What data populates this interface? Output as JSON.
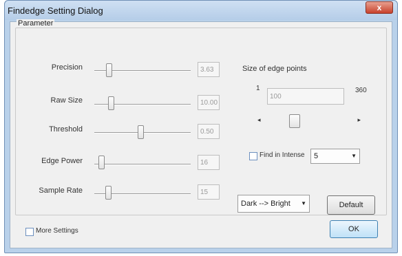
{
  "window": {
    "title": "Findedge Setting Dialog",
    "close_label": "x"
  },
  "parameter_group": {
    "title": "Parameter",
    "params": [
      {
        "label": "Precision",
        "value": "3.63",
        "slider_fraction": 0.15
      },
      {
        "label": "Raw Size",
        "value": "10.00",
        "slider_fraction": 0.17
      },
      {
        "label": "Threshold",
        "value": "0.50",
        "slider_fraction": 0.48
      },
      {
        "label": "Edge Power",
        "value": "16",
        "slider_fraction": 0.07
      },
      {
        "label": "Sample Rate",
        "value": "15",
        "slider_fraction": 0.14
      }
    ]
  },
  "edge_points": {
    "title": "Size of edge points",
    "min_label": "1",
    "max_label": "360",
    "value": "100",
    "scroll_fraction": 0.28
  },
  "find_in_intense": {
    "label": "Find in Intense",
    "value": "5",
    "checked": false
  },
  "direction_combo": {
    "value": "Dark --> Bright"
  },
  "default_button": {
    "label": "Default"
  },
  "more_settings": {
    "label": "More Settings",
    "checked": false
  },
  "ok_button": {
    "label": "OK"
  },
  "colors": {
    "frame": "#b9d1ea",
    "client": "#f0f0f0",
    "close": "#c8412c",
    "ok_border": "#3c7fb1"
  }
}
